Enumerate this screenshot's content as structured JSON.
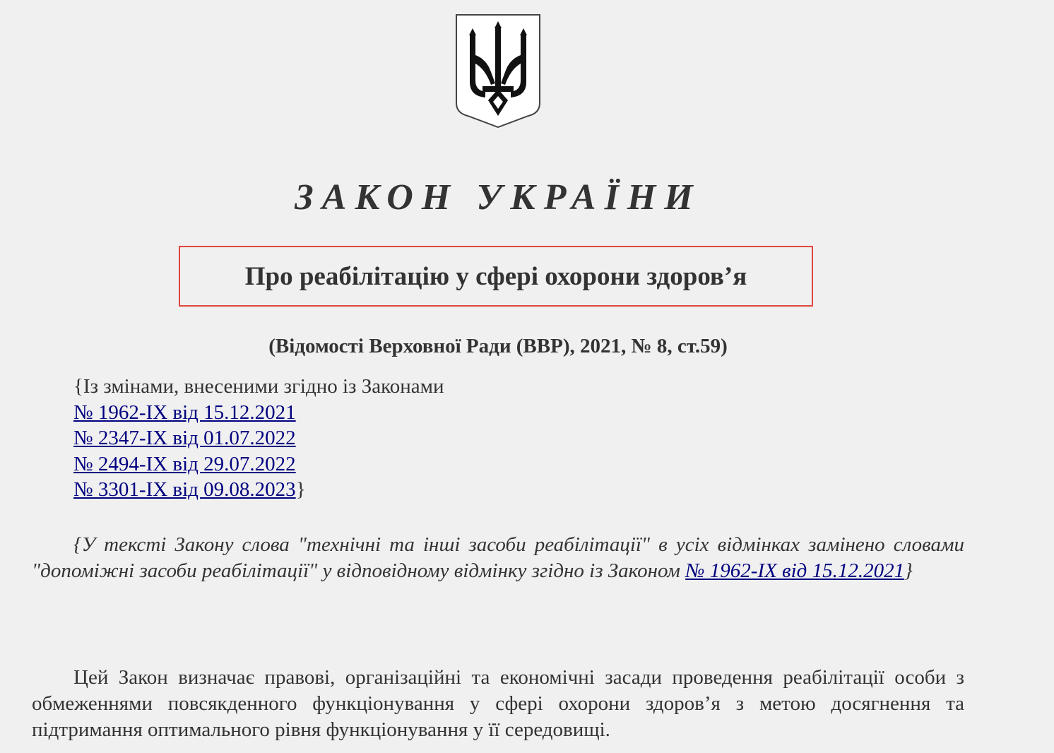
{
  "header": {
    "law_heading": "ЗАКОН УКРАЇНИ",
    "title": "Про реабілітацію у сфері охорони здоров’я",
    "gazette": "(Відомості Верховної Ради (ВВР), 2021, № 8, ст.59)"
  },
  "amendments": {
    "intro": "{Із змінами, внесеними згідно із Законами",
    "laws": [
      {
        "label": "№ 1962-IX від 15.12.2021"
      },
      {
        "label": "№ 2347-IX від 01.07.2022"
      },
      {
        "label": "№ 2494-IX від 29.07.2022"
      },
      {
        "label": "№ 3301-IX від 09.08.2023"
      }
    ],
    "closing": "}"
  },
  "note": {
    "text": "{У тексті Закону слова \"технічні та інші засоби реабілітації\" в усіх відмінках замінено словами \"допоміжні засоби реабілітації\" у відповідному відмінку згідно із Законом ",
    "link_label": "№ 1962-IX від 15.12.2021",
    "closing": "}"
  },
  "preamble": {
    "text": "Цей Закон визначає правові, організаційні та економічні засади проведення реабілітації особи з обмеженнями повсякденного функціонування у сфері охорони здоров’я з метою досягнення та підтримання оптимального рівня функціонування у її середовищі."
  },
  "icons": {
    "emblem": "coat-of-arms-of-ukraine-icon"
  },
  "colors": {
    "background": "#f0f0f0",
    "text": "#333333",
    "link": "#000080",
    "title_border": "#e0463f"
  }
}
